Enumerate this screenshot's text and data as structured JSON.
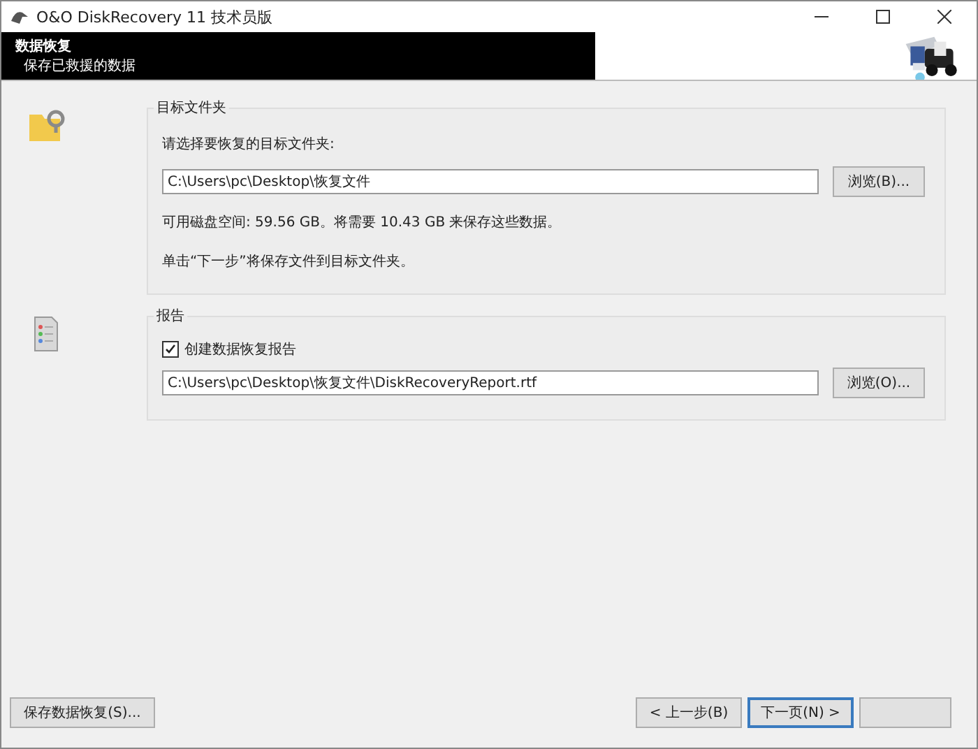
{
  "window": {
    "title": "O&O DiskRecovery 11 技术员版"
  },
  "header": {
    "title": "数据恢复",
    "subtitle": "保存已救援的数据"
  },
  "target_group": {
    "title": "目标文件夹",
    "prompt": "请选择要恢复的目标文件夹:",
    "path": "C:\\Users\\pc\\Desktop\\恢复文件",
    "browse": "浏览(B)...",
    "space_info": "可用磁盘空间: 59.56 GB。将需要 10.43 GB 来保存这些数据。",
    "hint": "单击“下一步”将保存文件到目标文件夹。"
  },
  "report_group": {
    "title": "报告",
    "checkbox": {
      "label": "创建数据恢复报告",
      "checked": true
    },
    "path": "C:\\Users\\pc\\Desktop\\恢复文件\\DiskRecoveryReport.rtf",
    "browse": "浏览(O)..."
  },
  "footer": {
    "save_button": "保存数据恢复(S)...",
    "back_button": "< 上一步(B)",
    "next_button": "下一页(N) >"
  }
}
